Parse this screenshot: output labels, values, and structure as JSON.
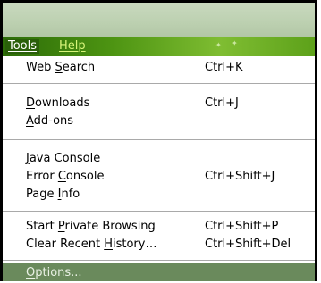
{
  "menubar": {
    "tools_label": "Tools",
    "help_label": "Help"
  },
  "menu": {
    "items": [
      {
        "pre": "Web ",
        "acc": "S",
        "post": "earch",
        "shortcut": "Ctrl+K"
      },
      {
        "pre": "",
        "acc": "D",
        "post": "ownloads",
        "shortcut": "Ctrl+J"
      },
      {
        "pre": "",
        "acc": "A",
        "post": "dd-ons",
        "shortcut": ""
      },
      {
        "pre": "",
        "acc": "J",
        "post": "ava Console",
        "shortcut": ""
      },
      {
        "pre": "Error ",
        "acc": "C",
        "post": "onsole",
        "shortcut": "Ctrl+Shift+J"
      },
      {
        "pre": "Page ",
        "acc": "I",
        "post": "nfo",
        "shortcut": ""
      },
      {
        "pre": "Start ",
        "acc": "P",
        "post": "rivate Browsing",
        "shortcut": "Ctrl+Shift+P"
      },
      {
        "pre": "Clear Recent ",
        "acc": "H",
        "post": "istory…",
        "shortcut": "Ctrl+Shift+Del"
      },
      {
        "pre": "",
        "acc": "O",
        "post": "ptions...",
        "shortcut": ""
      }
    ]
  }
}
